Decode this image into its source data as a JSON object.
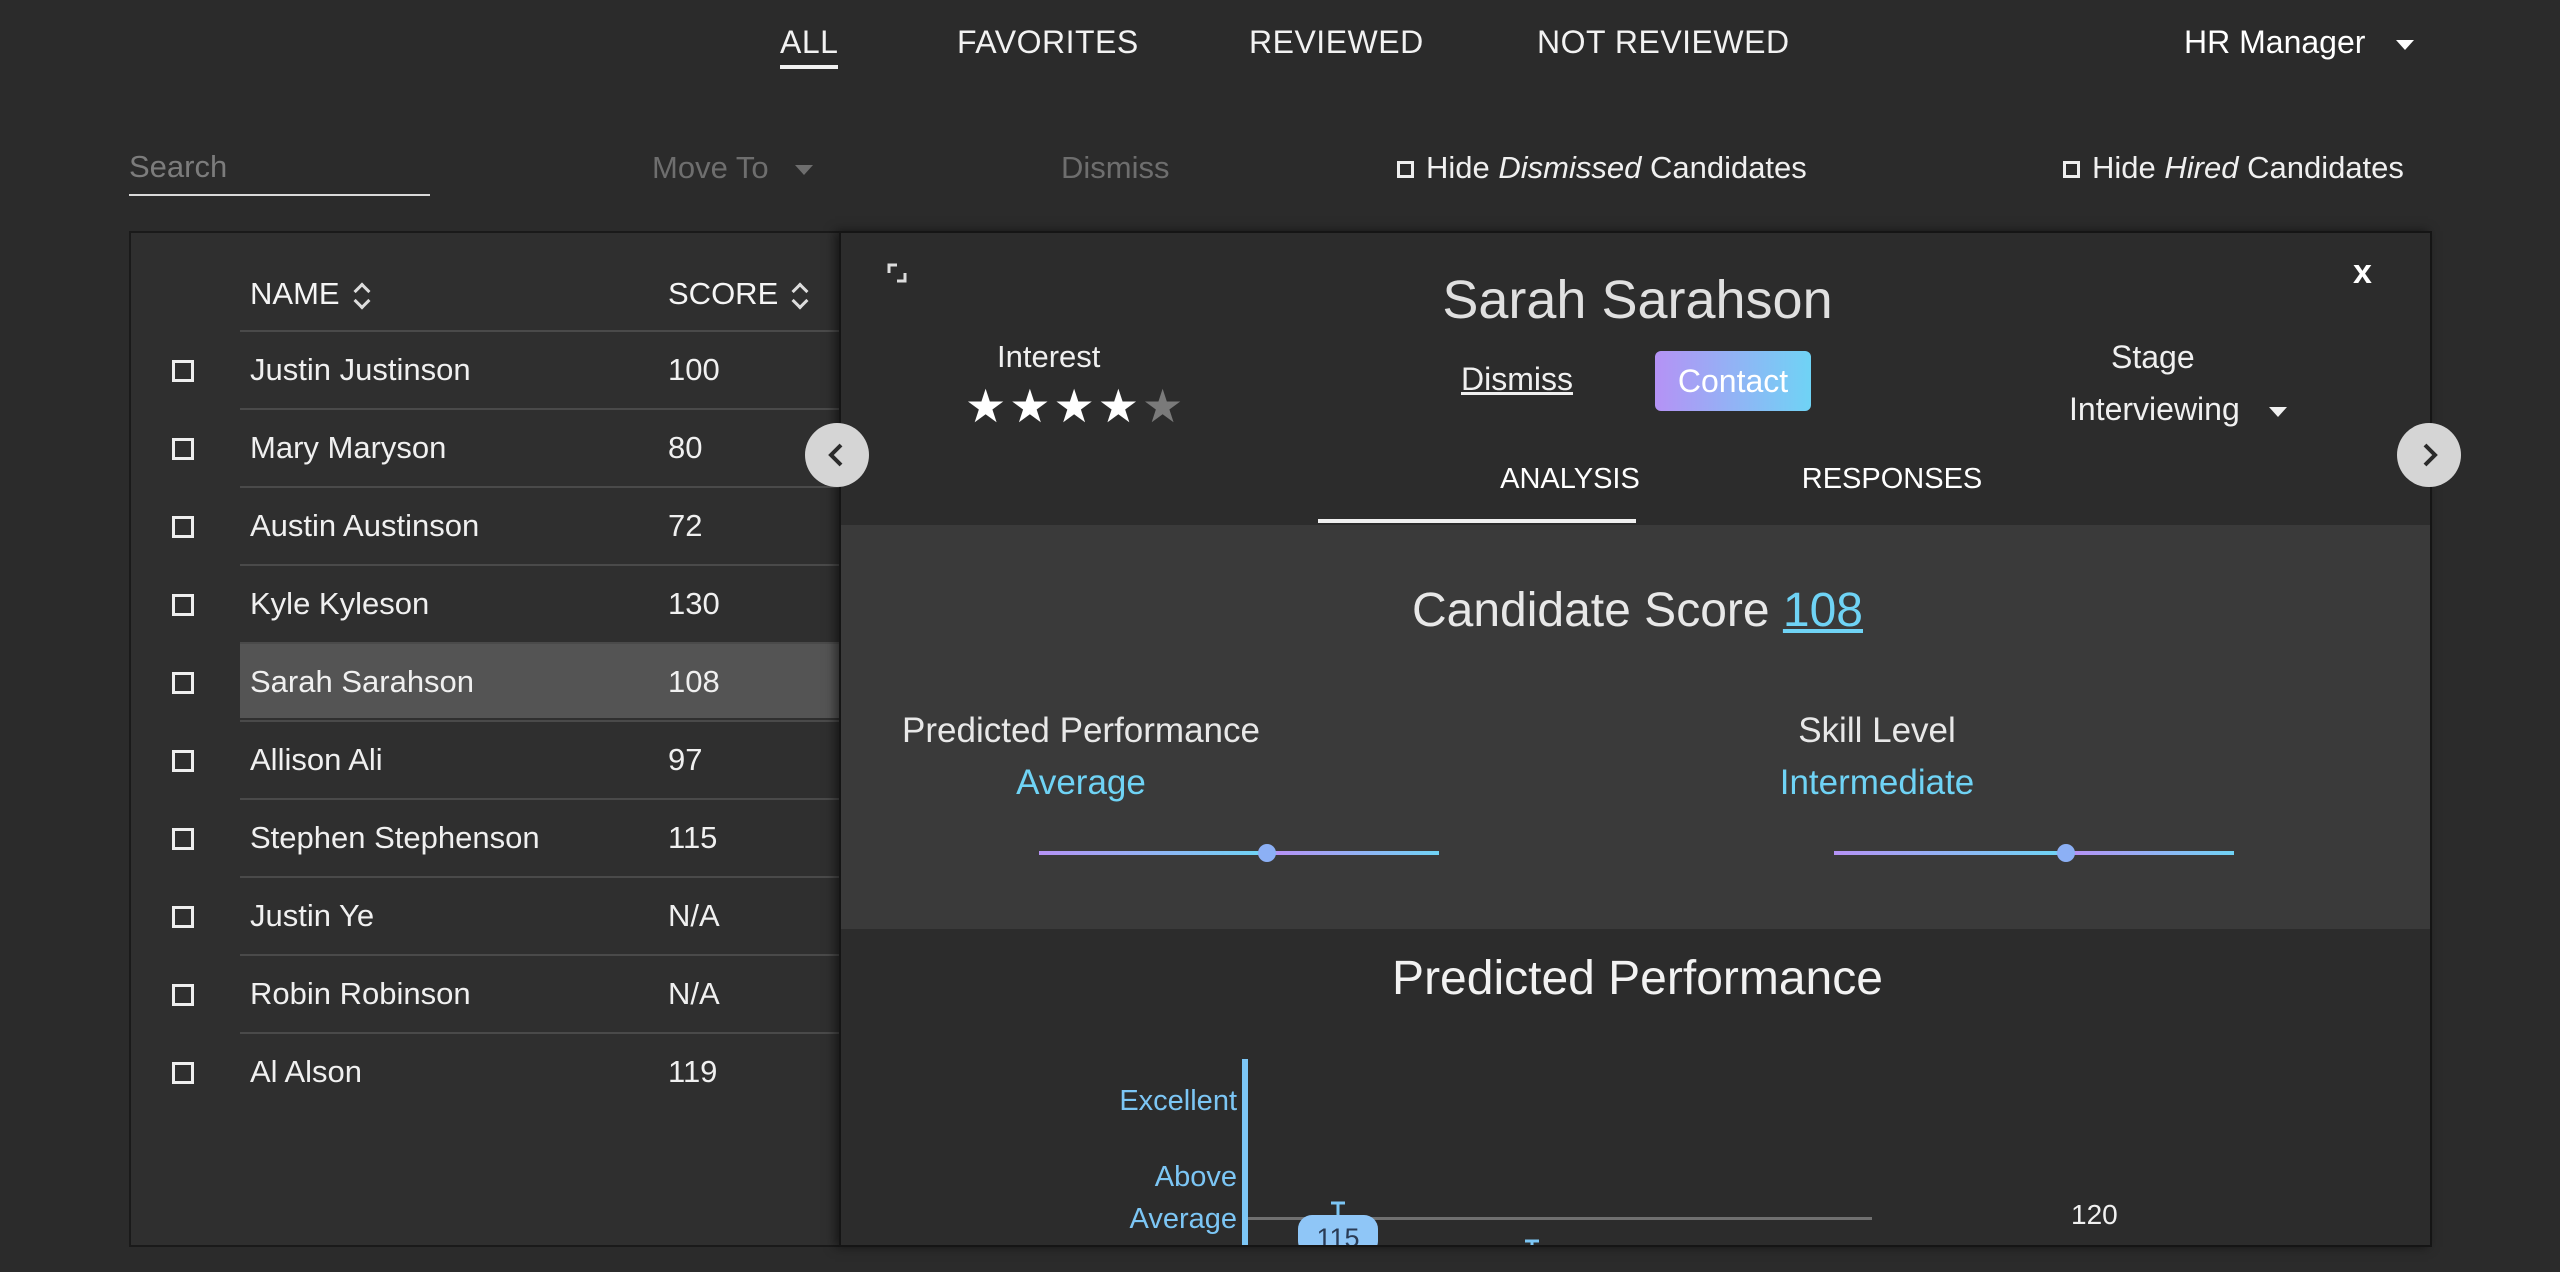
{
  "nav": {
    "tabs": [
      "ALL",
      "FAVORITES",
      "REVIEWED",
      "NOT REVIEWED"
    ],
    "role": "HR Manager"
  },
  "toolbar": {
    "search_placeholder": "Search",
    "move_to": "Move To",
    "dismiss": "Dismiss",
    "hide_dismissed_prefix": "Hide ",
    "hide_dismissed_em": "Dismissed",
    "hide_dismissed_suffix": " Candidates",
    "hide_hired_prefix": "Hide ",
    "hide_hired_em": "Hired",
    "hide_hired_suffix": " Candidates"
  },
  "table": {
    "headers": {
      "name": "NAME",
      "score": "SCORE"
    },
    "rows": [
      {
        "name": "Justin Justinson",
        "score": "100"
      },
      {
        "name": "Mary Maryson",
        "score": "80"
      },
      {
        "name": "Austin Austinson",
        "score": "72"
      },
      {
        "name": "Kyle Kyleson",
        "score": "130"
      },
      {
        "name": "Sarah Sarahson",
        "score": "108"
      },
      {
        "name": "Allison Ali",
        "score": "97"
      },
      {
        "name": "Stephen Stephenson",
        "score": "115"
      },
      {
        "name": "Justin Ye",
        "score": "N/A"
      },
      {
        "name": "Robin Robinson",
        "score": "N/A"
      },
      {
        "name": "Al Alson",
        "score": "119"
      }
    ],
    "selected_row": "Sarah Sarahson"
  },
  "detail": {
    "name": "Sarah Sarahson",
    "close": "x",
    "interest_label": "Interest",
    "interest_rating": 4,
    "interest_max": 5,
    "dismiss": "Dismiss",
    "contact": "Contact",
    "stage_label": "Stage",
    "stage_value": "Interviewing",
    "tabs": [
      "ANALYSIS",
      "RESPONSES"
    ],
    "active_tab": "ANALYSIS",
    "score_label": "Candidate Score ",
    "score_value": "108",
    "metrics": [
      {
        "label": "Predicted Performance",
        "value": "Average",
        "level": 0.57
      },
      {
        "label": "Skill Level",
        "value": "Intermediate",
        "level": 0.58
      }
    ],
    "chart": {
      "title": "Predicted Performance",
      "y_labels": [
        "Excellent",
        "Above",
        "Average"
      ],
      "bubble": "115",
      "ref_value": "120"
    }
  },
  "colors": {
    "accent_cyan": "#6fd3f5",
    "accent_purple": "#b592f5",
    "background": "#2b2b2b"
  }
}
